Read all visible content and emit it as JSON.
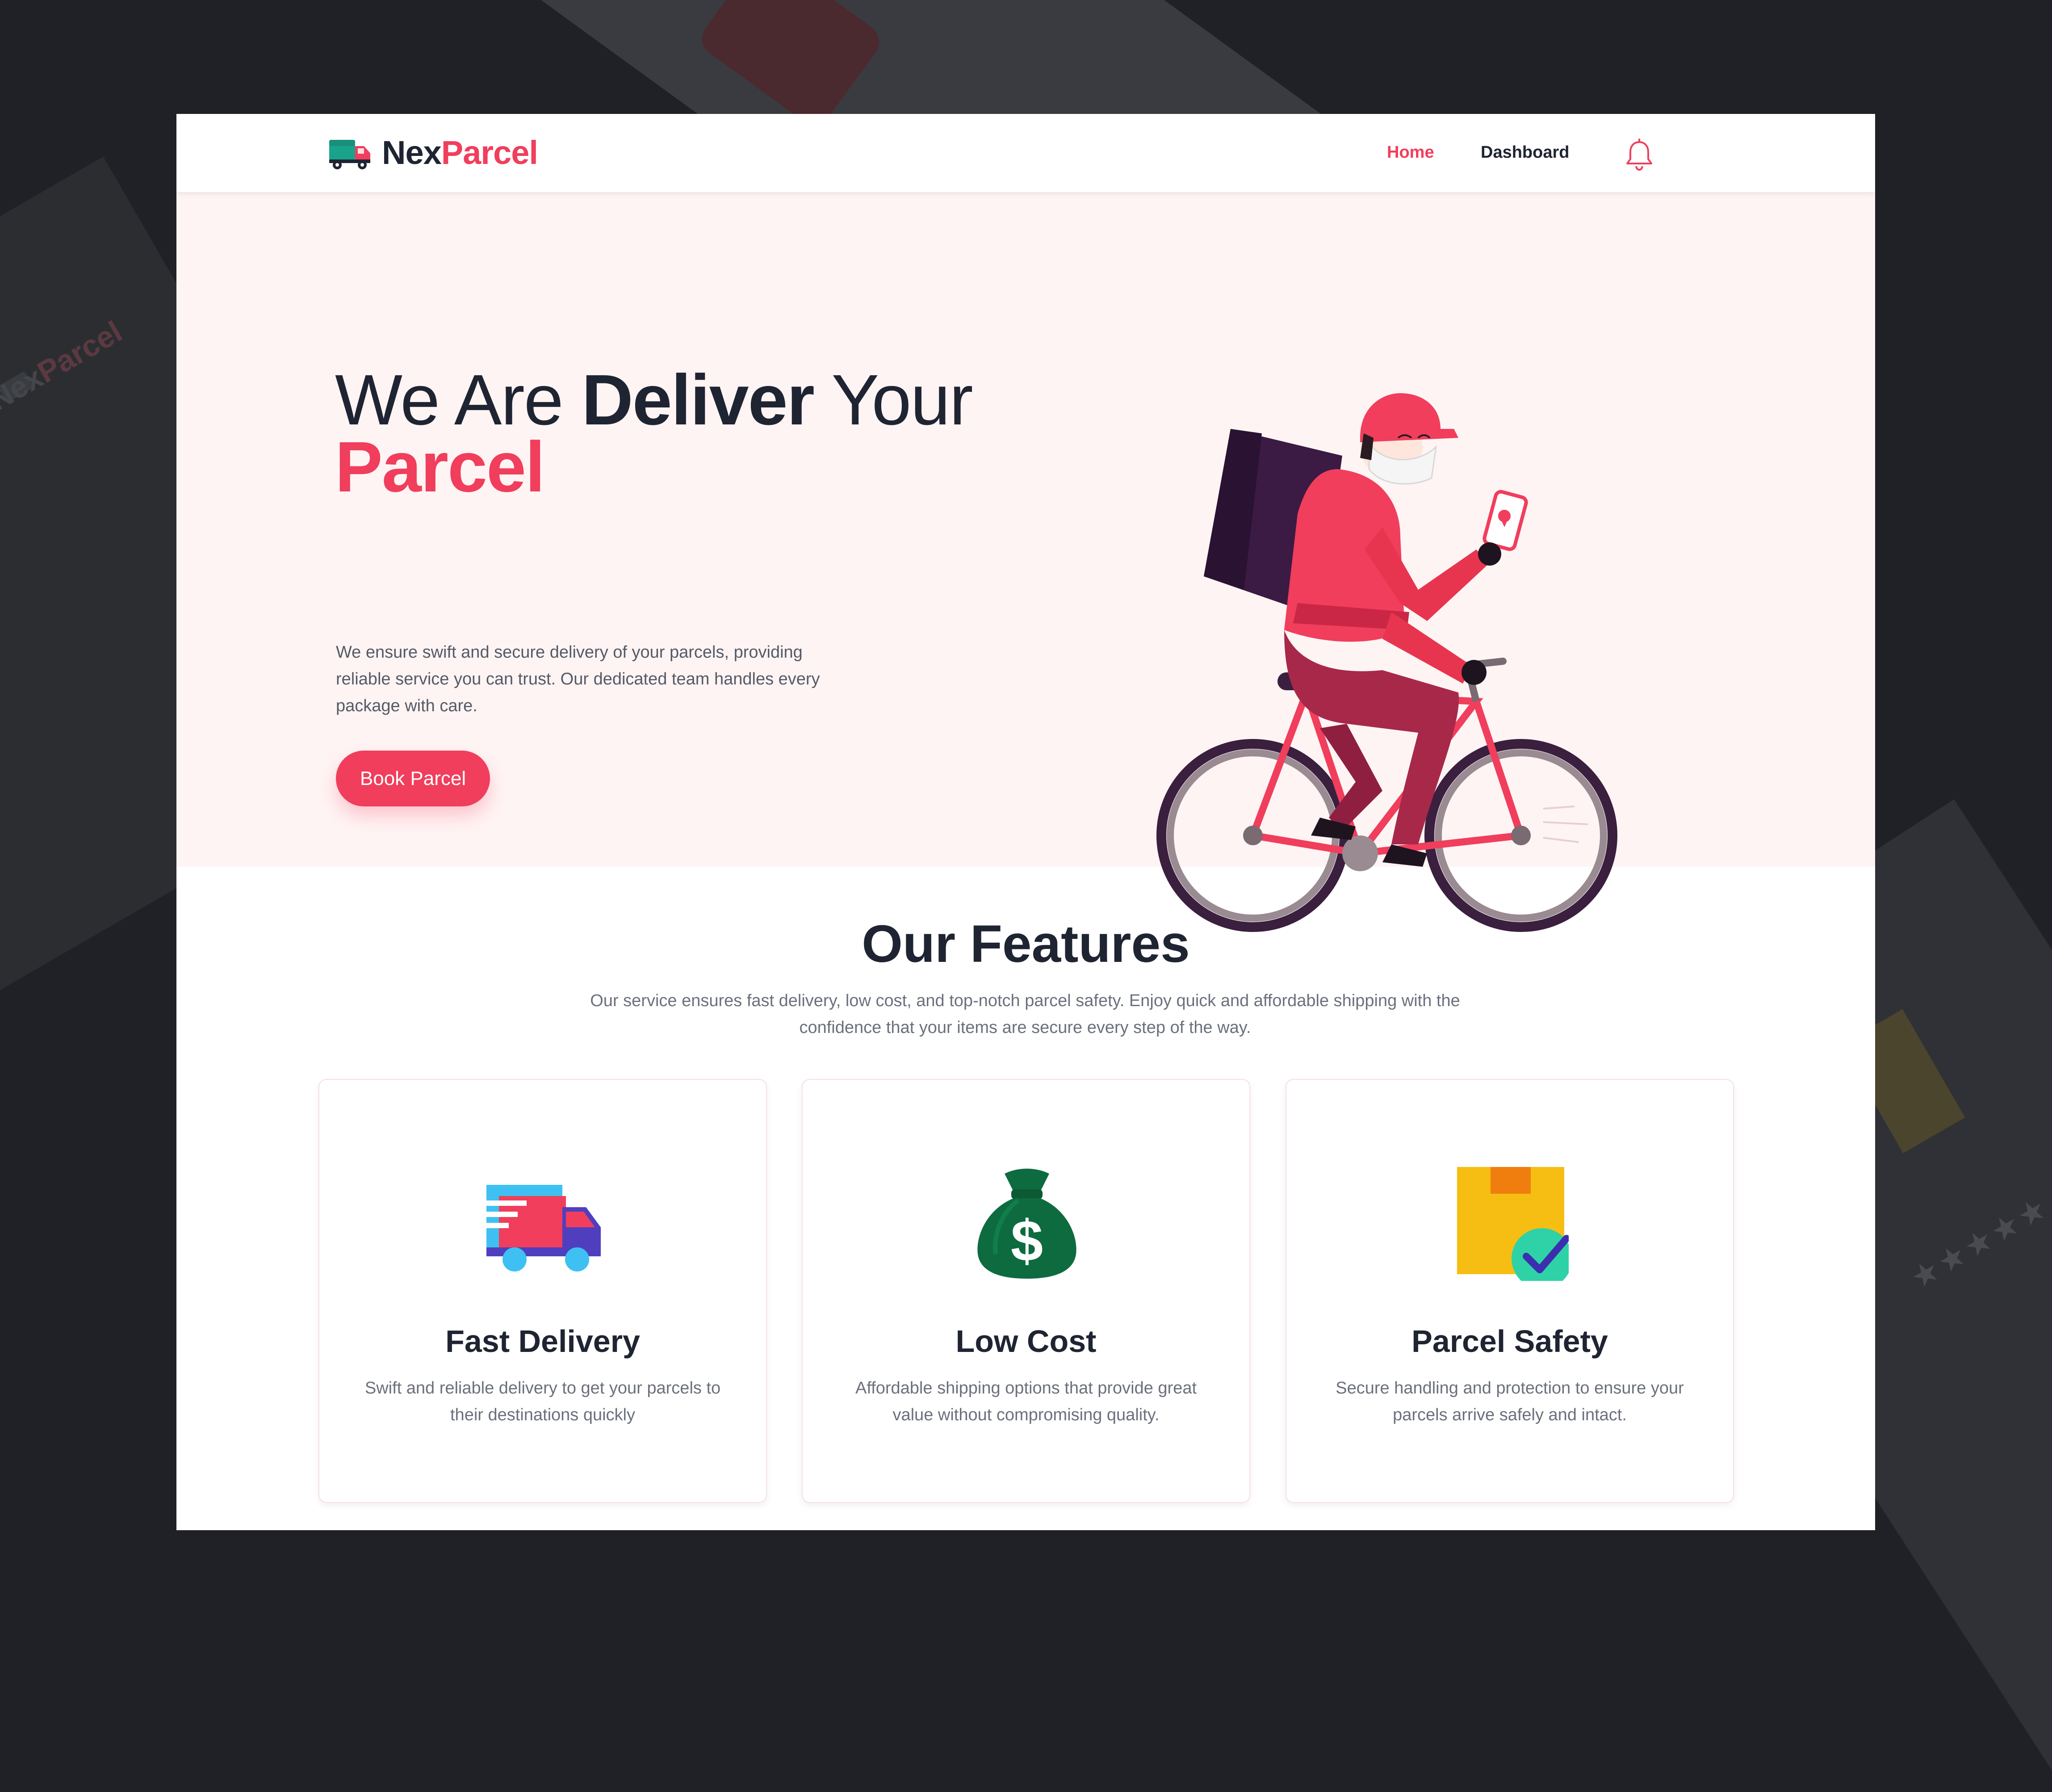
{
  "brand": {
    "name_part1": "Nex",
    "name_part2": "Parcel",
    "accent_color": "#f03e5c",
    "dark_color": "#1f2432",
    "logo_icon": "delivery-truck-icon"
  },
  "nav": {
    "items": [
      {
        "label": "Home",
        "active": true
      },
      {
        "label": "Dashboard",
        "active": false
      }
    ],
    "notification_icon": "bell-icon"
  },
  "hero": {
    "title_part1": "We Are ",
    "title_part2": "Deliver",
    "title_part3": " Your",
    "title_part4": "Parcel",
    "description": "We ensure swift and secure delivery of your parcels, providing reliable service you can trust. Our dedicated team handles every package with care.",
    "button_label": "Book Parcel",
    "background_color": "#fff4f4",
    "illustration": "delivery-rider-bicycle-illustration"
  },
  "features": {
    "title": "Our Features",
    "subtitle": "Our service ensures fast delivery, low cost, and top-notch parcel safety. Enjoy quick and affordable shipping with the confidence that your items are secure every step of the way.",
    "cards": [
      {
        "icon": "delivery-truck-icon",
        "title": "Fast Delivery",
        "description": "Swift and reliable delivery to get your parcels to their destinations quickly"
      },
      {
        "icon": "money-bag-icon",
        "title": "Low Cost",
        "description": "Affordable shipping options that provide great value without compromising quality."
      },
      {
        "icon": "parcel-check-icon",
        "title": "Parcel Safety",
        "description": "Secure handling and protection to ensure your parcels arrive safely and intact."
      }
    ]
  }
}
